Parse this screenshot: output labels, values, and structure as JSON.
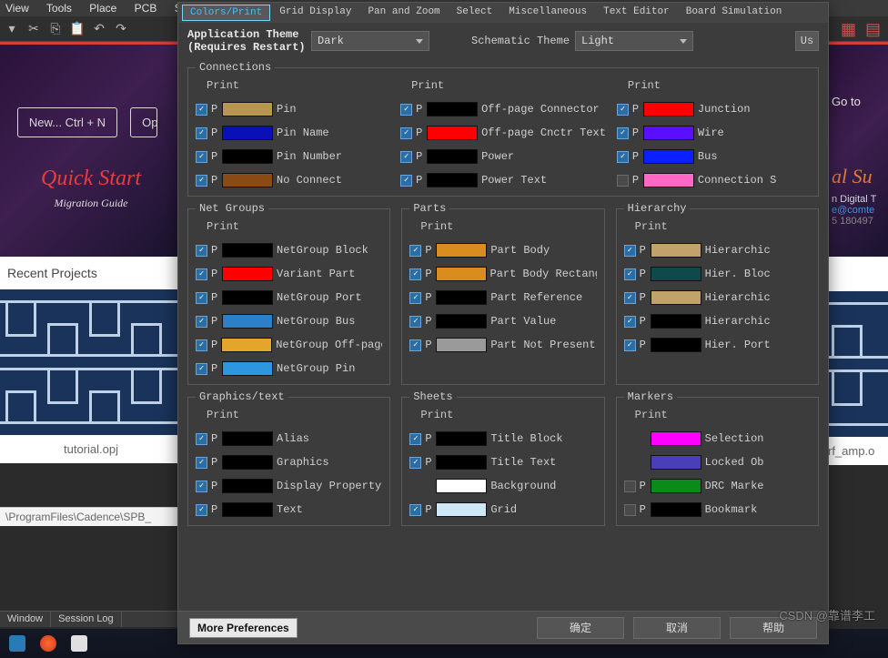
{
  "app_menu": [
    "View",
    "Tools",
    "Place",
    "PCB",
    "SI"
  ],
  "bg": {
    "new_btn": "New... Ctrl + N",
    "open_btn": "Ope",
    "quick": "Quick Start",
    "mig": "Migration Guide",
    "recent": "Recent Projects",
    "tutorial": "tutorial.opj",
    "path": "\\ProgramFiles\\Cadence\\SPB_",
    "goto": "Go to",
    "alS": "al Su",
    "rt1": "n Digital T",
    "rt2": "e@comte",
    "rt3": "5 180497",
    "rf": "rf_amp.o"
  },
  "tabs": [
    "Colors/Print",
    "Grid Display",
    "Pan and Zoom",
    "Select",
    "Miscellaneous",
    "Text Editor",
    "Board Simulation"
  ],
  "active_tab": "Colors/Print",
  "themes": {
    "app_label": "Application Theme (Requires Restart)",
    "app_value": "Dark",
    "schem_label": "Schematic Theme",
    "schem_value": "Light",
    "us_btn": "Us"
  },
  "groups": {
    "connections": {
      "legend": "Connections",
      "print": "Print",
      "cols": [
        [
          {
            "chk": true,
            "color": "#b79651",
            "label": "Pin"
          },
          {
            "chk": true,
            "color": "#0a10b8",
            "label": "Pin Name"
          },
          {
            "chk": true,
            "color": "#000000",
            "label": "Pin Number"
          },
          {
            "chk": true,
            "color": "#8a4a14",
            "label": "No Connect"
          }
        ],
        [
          {
            "chk": true,
            "color": "#000000",
            "label": "Off-page Connector"
          },
          {
            "chk": true,
            "color": "#ff0000",
            "label": "Off-page Cnctr Text"
          },
          {
            "chk": true,
            "color": "#000000",
            "label": "Power"
          },
          {
            "chk": true,
            "color": "#000000",
            "label": "Power Text"
          }
        ],
        [
          {
            "chk": true,
            "color": "#ff0000",
            "label": "Junction"
          },
          {
            "chk": true,
            "color": "#5a10ff",
            "label": "Wire"
          },
          {
            "chk": true,
            "color": "#0a20ff",
            "label": "Bus"
          },
          {
            "chk": false,
            "color": "#ff68c4",
            "label": "Connection S"
          }
        ]
      ]
    },
    "netgroups": {
      "legend": "Net Groups",
      "print": "Print",
      "items": [
        {
          "chk": true,
          "color": "#000000",
          "label": "NetGroup Block"
        },
        {
          "chk": true,
          "color": "#ff0000",
          "label": "Variant Part"
        },
        {
          "chk": true,
          "color": "#000000",
          "label": "NetGroup Port"
        },
        {
          "chk": true,
          "color": "#2d80c6",
          "label": "NetGroup Bus"
        },
        {
          "chk": true,
          "color": "#e3a62b",
          "label": "NetGroup Off-page Cnctr"
        },
        {
          "chk": true,
          "color": "#2d96e0",
          "label": "NetGroup Pin"
        }
      ]
    },
    "parts": {
      "legend": "Parts",
      "print": "Print",
      "items": [
        {
          "chk": true,
          "color": "#da8c1e",
          "label": "Part Body"
        },
        {
          "chk": true,
          "color": "#da8c1e",
          "label": "Part Body Rectangle"
        },
        {
          "chk": true,
          "color": "#000000",
          "label": "Part Reference"
        },
        {
          "chk": true,
          "color": "#000000",
          "label": "Part Value"
        },
        {
          "chk": true,
          "color": "#9a9a9a",
          "label": "Part Not Present"
        }
      ]
    },
    "hierarchy": {
      "legend": "Hierarchy",
      "print": "Print",
      "items": [
        {
          "chk": true,
          "color": "#c0a26a",
          "label": "Hierarchic"
        },
        {
          "chk": true,
          "color": "#0f4a4a",
          "label": "Hier. Bloc"
        },
        {
          "chk": true,
          "color": "#c0a26a",
          "label": "Hierarchic"
        },
        {
          "chk": true,
          "color": "#000000",
          "label": "Hierarchic"
        },
        {
          "chk": true,
          "color": "#000000",
          "label": "Hier. Port"
        }
      ]
    },
    "graphics": {
      "legend": "Graphics/text",
      "print": "Print",
      "items": [
        {
          "chk": true,
          "color": "#000000",
          "label": "Alias"
        },
        {
          "chk": true,
          "color": "#000000",
          "label": "Graphics"
        },
        {
          "chk": true,
          "color": "#000000",
          "label": "Display Property"
        },
        {
          "chk": true,
          "color": "#000000",
          "label": "Text"
        }
      ]
    },
    "sheets": {
      "legend": "Sheets",
      "print": "Print",
      "items": [
        {
          "chk": true,
          "color": "#000000",
          "label": "Title Block"
        },
        {
          "chk": true,
          "color": "#000000",
          "label": "Title Text"
        },
        {
          "chk": null,
          "color": "#ffffff",
          "label": "Background"
        },
        {
          "chk": true,
          "color": "#cfe8f7",
          "label": "Grid"
        }
      ]
    },
    "markers": {
      "legend": "Markers",
      "print": "Print",
      "items": [
        {
          "chk": null,
          "color": "#ff00ff",
          "label": "Selection"
        },
        {
          "chk": null,
          "color": "#4a3fb8",
          "label": "Locked Ob"
        },
        {
          "chk": false,
          "color": "#0a8a1a",
          "label": "DRC Marke"
        },
        {
          "chk": false,
          "color": "#000000",
          "label": "Bookmark"
        }
      ]
    }
  },
  "buttons": {
    "more": "More Preferences",
    "ok": "确定",
    "cancel": "取消",
    "help": "帮助"
  },
  "status": [
    "Window",
    "Session Log"
  ],
  "watermark": "CSDN @靠谱李工"
}
